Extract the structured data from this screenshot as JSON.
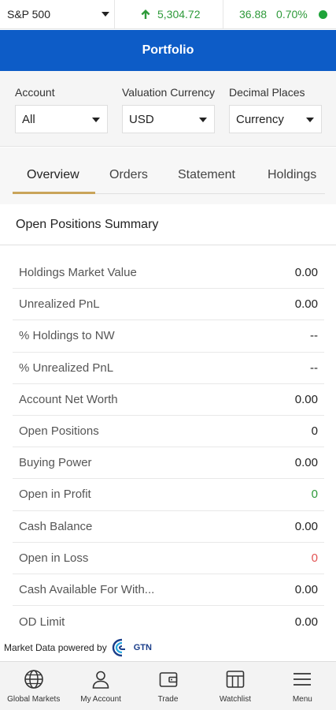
{
  "ticker": {
    "symbol": "S&P 500",
    "price": "5,304.72",
    "change": "36.88",
    "percent": "0.70%",
    "up_color": "#2e9a3a",
    "status_color": "#1fa33a"
  },
  "header": {
    "title": "Portfolio",
    "bg_color": "#0d5cc7"
  },
  "filters": {
    "account": {
      "label": "Account",
      "value": "All"
    },
    "currency": {
      "label": "Valuation Currency",
      "value": "USD"
    },
    "decimals": {
      "label": "Decimal Places",
      "value": "Currency"
    }
  },
  "tabs": [
    {
      "label": "Overview",
      "active": true
    },
    {
      "label": "Orders"
    },
    {
      "label": "Statement"
    },
    {
      "label": "Holdings"
    }
  ],
  "summary": {
    "title": "Open Positions Summary",
    "rows": [
      {
        "label": "Holdings Market Value",
        "value": "0.00"
      },
      {
        "label": "Unrealized PnL",
        "value": "0.00"
      },
      {
        "label": "% Holdings to NW",
        "value": "--"
      },
      {
        "label": "% Unrealized PnL",
        "value": "--"
      },
      {
        "label": "Account Net Worth",
        "value": "0.00"
      },
      {
        "label": "Open Positions",
        "value": "0"
      },
      {
        "label": "Buying Power",
        "value": "0.00"
      },
      {
        "label": "Open in Profit",
        "value": "0"
      },
      {
        "label": "Cash Balance",
        "value": "0.00"
      },
      {
        "label": "Open in Loss",
        "value": "0"
      },
      {
        "label": "Cash Available For With...",
        "value": "0.00"
      },
      {
        "label": "OD Limit",
        "value": "0.00"
      }
    ]
  },
  "powered": {
    "text": "Market Data powered by",
    "brand": "GTN"
  },
  "bottom_nav": [
    {
      "label": "Global Markets",
      "icon": "globe-icon"
    },
    {
      "label": "My Account",
      "icon": "user-icon"
    },
    {
      "label": "Trade",
      "icon": "wallet-icon"
    },
    {
      "label": "Watchlist",
      "icon": "watchlist-icon"
    },
    {
      "label": "Menu",
      "icon": "menu-icon"
    }
  ]
}
